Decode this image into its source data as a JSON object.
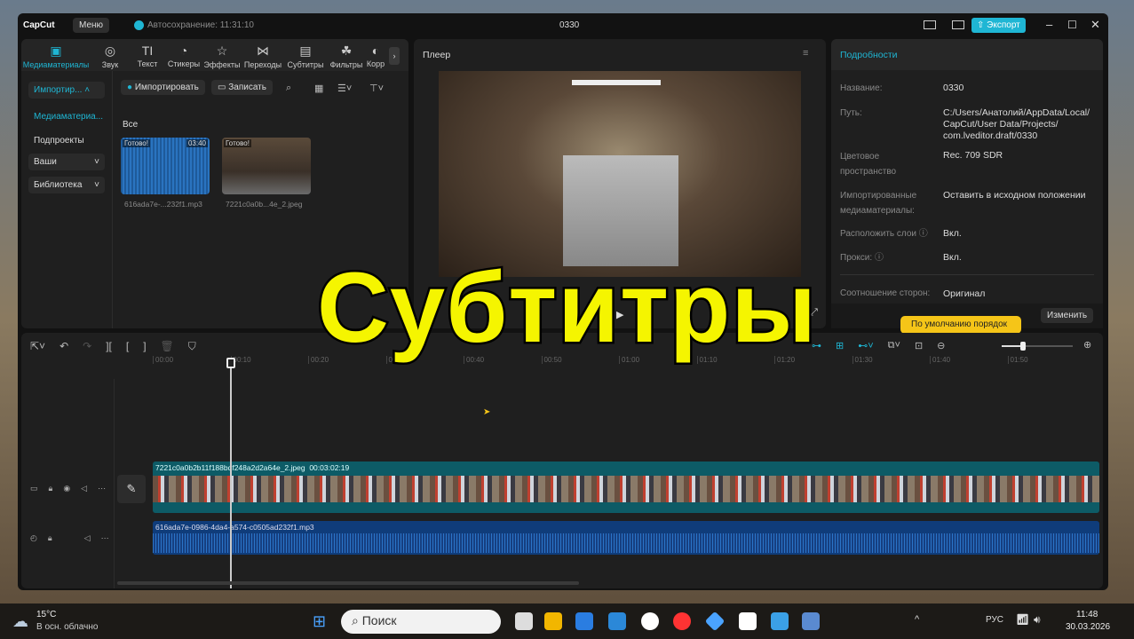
{
  "app": {
    "logo": "CapCut",
    "menu": "Меню",
    "autosave": "Автосохранение: 11:31:10",
    "project_title": "0330",
    "export": "Экспорт"
  },
  "toolbar": [
    {
      "label": "Медиаматериалы",
      "icon": "media-icon"
    },
    {
      "label": "Звук",
      "icon": "audio-icon"
    },
    {
      "label": "Текст",
      "icon": "text-icon"
    },
    {
      "label": "Стикеры",
      "icon": "sticker-icon"
    },
    {
      "label": "Эффекты",
      "icon": "effects-icon"
    },
    {
      "label": "Переходы",
      "icon": "transitions-icon"
    },
    {
      "label": "Субтитры",
      "icon": "captions-icon"
    },
    {
      "label": "Фильтры",
      "icon": "filters-icon"
    },
    {
      "label": "Корр",
      "icon": "adjust-icon"
    }
  ],
  "sidebar": {
    "import": "Импортир...",
    "media": "Медиаматериа...",
    "subprojects": "Подпроекты",
    "yours": "Ваши",
    "library": "Библиотека"
  },
  "media": {
    "import_btn": "Импортировать",
    "record_btn": "Записать",
    "filter": "Все",
    "items": [
      {
        "status": "Готово!",
        "duration": "03:40",
        "name": "616ada7e-...232f1.mp3"
      },
      {
        "status": "Готово!",
        "name": "7221c0a0b...4e_2.jpeg"
      }
    ]
  },
  "player": {
    "title": "Плеер"
  },
  "details": {
    "title": "Подробности",
    "rows": [
      {
        "label": "Название:",
        "value": "0330"
      },
      {
        "label": "Путь:",
        "value": "C:/Users/Анатолий/AppData/Local/ CapCut/User Data/Projects/ com.lveditor.draft/0330"
      },
      {
        "label": "Цветовое пространство",
        "value": "Rec. 709 SDR"
      },
      {
        "label": "Импортированные медиаматериалы:",
        "value": "Оставить в исходном положении"
      },
      {
        "label": "Расположить слои",
        "value": "Вкл."
      },
      {
        "label": "Прокси:",
        "value": "Вкл."
      },
      {
        "label": "Соотношение сторон:",
        "value": "Оригинал"
      }
    ],
    "change_btn": "Изменить",
    "tooltip": "По умолчанию порядок"
  },
  "timeline": {
    "ticks": [
      "00:00",
      "00:10",
      "00:20",
      "00:30",
      "00:40",
      "00:50",
      "01:00",
      "01:10",
      "01:20",
      "01:30",
      "01:40",
      "01:50"
    ],
    "video_clip": "7221c0a0b2b11f188bdf248a2d2a64e_2.jpeg",
    "video_duration": "00:03:02:19",
    "audio_clip": "616ada7e-0986-4da4-a574-c0505ad232f1.mp3",
    "zoom_level": 0.18
  },
  "overlay": "Субтитры",
  "taskbar": {
    "temp": "15°C",
    "weather": "В осн. облачно",
    "search": "Поиск",
    "lang": "РУС",
    "time": "11:48",
    "date": "30.03.2026"
  }
}
